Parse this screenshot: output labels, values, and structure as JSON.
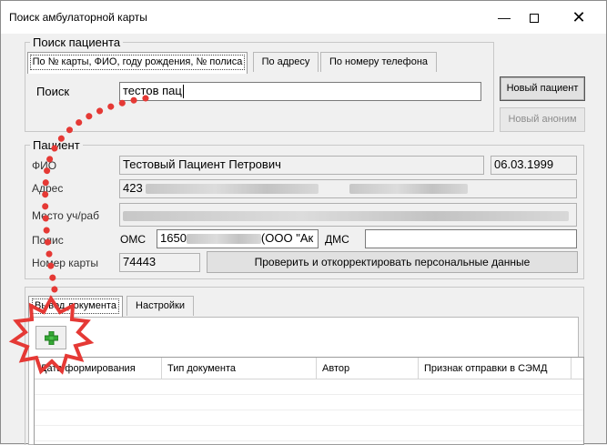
{
  "window": {
    "title": "Поиск амбулаторной карты"
  },
  "search": {
    "legend": "Поиск пациента",
    "tabs": [
      {
        "label": "По № карты, ФИО, году рождения, № полиса",
        "active": true
      },
      {
        "label": "По адресу",
        "active": false
      },
      {
        "label": "По номеру телефона",
        "active": false
      }
    ],
    "label": "Поиск",
    "value": "тестов пац",
    "new_patient_label": "Новый пациент",
    "new_anonymous_label": "Новый аноним"
  },
  "patient": {
    "legend": "Пациент",
    "fio_label": "ФИО",
    "fio_value": "Тестовый Пациент Петрович",
    "birthdate": "06.03.1999",
    "address_label": "Адрес",
    "address_prefix": "423",
    "work_label": "Место уч/раб",
    "policy_label": "Полис",
    "oms_label": "ОМС",
    "policy_prefix": "1650",
    "policy_suffix": "(ООО \"Ак",
    "dms_label": "ДМС",
    "card_label": "Номер карты",
    "card_value": "74443",
    "verify_button_label": "Проверить и откорректировать персональные данные"
  },
  "docs": {
    "tabs": [
      {
        "label": "Вывод документа",
        "active": true
      },
      {
        "label": "Настройки",
        "active": false
      }
    ],
    "add_icon": "plus-icon",
    "columns": [
      "Дата формирования",
      "Тип документа",
      "Автор",
      "Признак отправки в СЭМД"
    ]
  },
  "colors": {
    "annotation": "#e53935",
    "add_icon": "#35a835"
  }
}
